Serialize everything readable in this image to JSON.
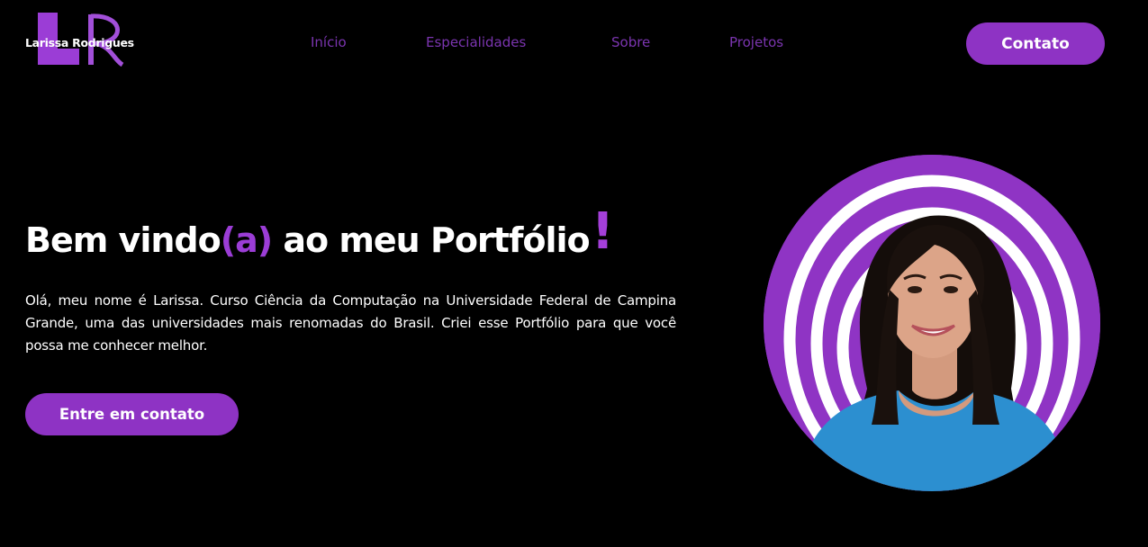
{
  "brand": {
    "name": "Larissa Rodrigues",
    "monogram": "LR"
  },
  "nav": {
    "items": [
      "Início",
      "Especialidades",
      "Sobre",
      "Projetos"
    ]
  },
  "header": {
    "contact_label": "Contato"
  },
  "hero": {
    "title_part1": "Bem vindo",
    "title_accent": "(a)",
    "title_part2": " ao meu Portfólio",
    "title_bang": "!",
    "description": "Olá, meu nome é Larissa. Curso Ciência da Computação na Universidade Federal de Campina Grande, uma das universidades mais renomadas do Brasil. Criei esse Portfólio para que você possa me conhecer melhor.",
    "cta_label": "Entre em contato"
  },
  "theme": {
    "accent": "#8e33c4",
    "nav_text": "#7b35b0",
    "background": "#000000"
  }
}
